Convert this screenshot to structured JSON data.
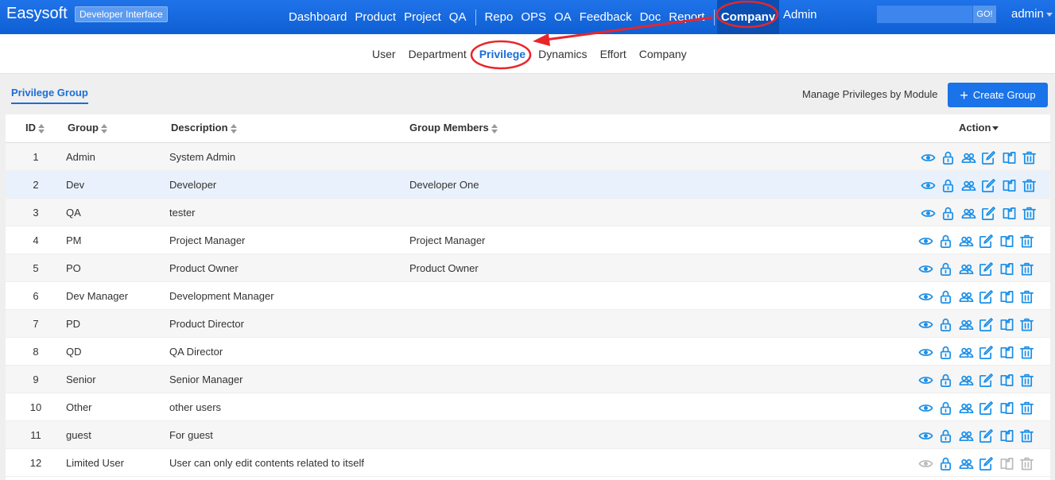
{
  "app": {
    "brand": "Easysoft",
    "badge": "Developer Interface"
  },
  "topnav": {
    "items": [
      "Dashboard",
      "Product",
      "Project",
      "QA",
      "Repo",
      "OPS",
      "OA",
      "Feedback",
      "Doc",
      "Report"
    ],
    "active": "Company",
    "after": "Admin",
    "search_value": "",
    "go_label": "GO!",
    "user": "admin"
  },
  "subnav": {
    "items": [
      "User",
      "Department",
      "Privilege",
      "Dynamics",
      "Effort",
      "Company"
    ],
    "active_index": 2
  },
  "toolbar": {
    "tab": "Privilege Group",
    "manage_link": "Manage Privileges by Module",
    "create_button": "Create Group"
  },
  "table": {
    "columns": [
      "ID",
      "Group",
      "Description",
      "Group Members",
      "Action"
    ],
    "rows": [
      {
        "id": "1",
        "group": "Admin",
        "description": "System Admin",
        "members": ""
      },
      {
        "id": "2",
        "group": "Dev",
        "description": "Developer",
        "members": "Developer One"
      },
      {
        "id": "3",
        "group": "QA",
        "description": "tester",
        "members": ""
      },
      {
        "id": "4",
        "group": "PM",
        "description": "Project Manager",
        "members": "Project Manager"
      },
      {
        "id": "5",
        "group": "PO",
        "description": "Product Owner",
        "members": "Product Owner"
      },
      {
        "id": "6",
        "group": "Dev Manager",
        "description": "Development Manager",
        "members": ""
      },
      {
        "id": "7",
        "group": "PD",
        "description": "Product Director",
        "members": ""
      },
      {
        "id": "8",
        "group": "QD",
        "description": "QA Director",
        "members": ""
      },
      {
        "id": "9",
        "group": "Senior",
        "description": "Senior Manager",
        "members": ""
      },
      {
        "id": "10",
        "group": "Other",
        "description": "other users",
        "members": ""
      },
      {
        "id": "11",
        "group": "guest",
        "description": "For guest",
        "members": ""
      },
      {
        "id": "12",
        "group": "Limited User",
        "description": "User can only edit contents related to itself",
        "members": ""
      }
    ],
    "row_actions": [
      "view-icon",
      "lock-icon",
      "members-icon",
      "edit-icon",
      "copy-icon",
      "delete-icon"
    ]
  },
  "colors": {
    "topbar": "#1668e0",
    "accent": "#1a6ed8",
    "icon": "#1a8fe8",
    "icon_disabled": "#bbbbbb",
    "annotation": "#e8262a"
  }
}
